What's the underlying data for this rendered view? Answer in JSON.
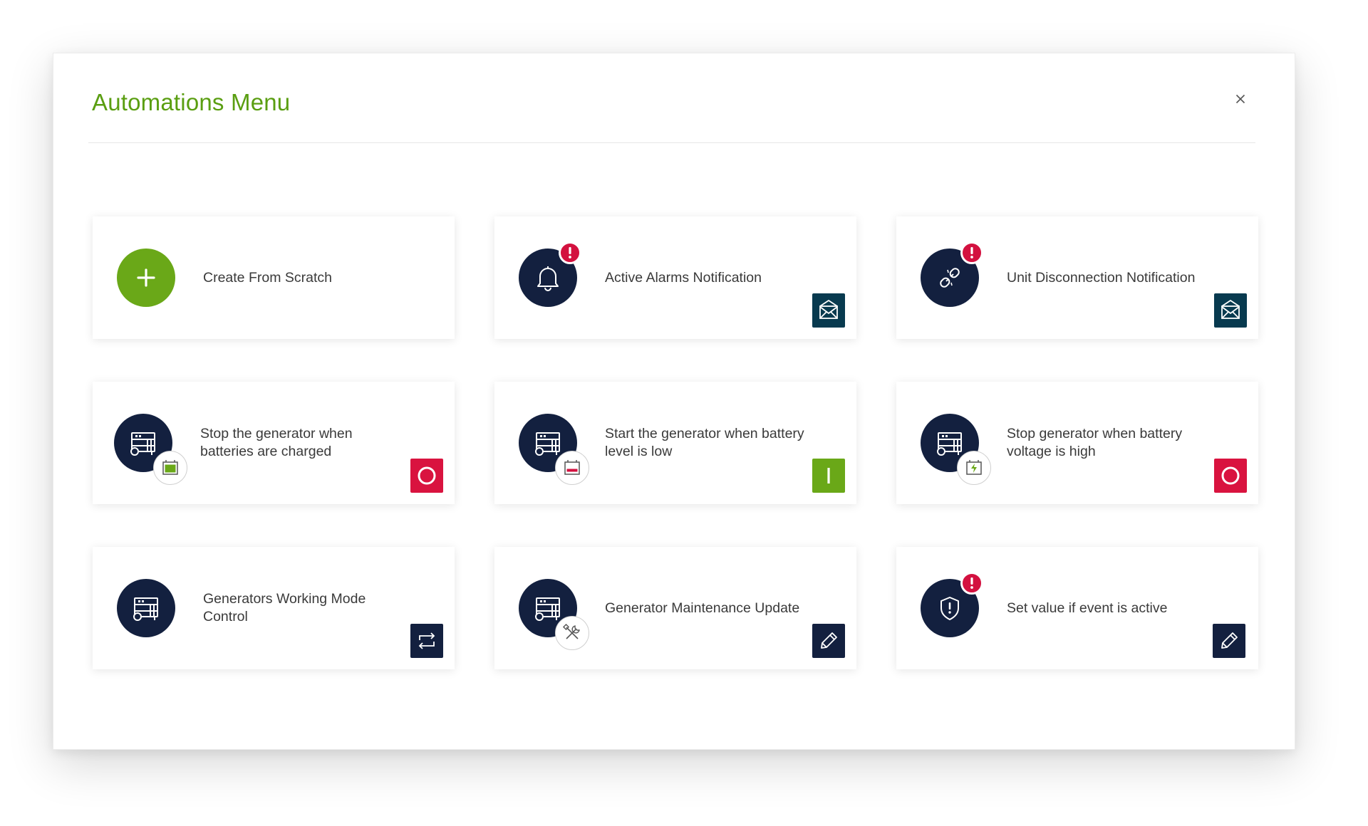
{
  "modal": {
    "title": "Automations Menu",
    "close_label": "×"
  },
  "colors": {
    "title_green": "#5a9e11",
    "navy": "#13203f",
    "teal": "#083a4f",
    "alert_red": "#d3113f",
    "off_red": "#d9133f",
    "on_green": "#6aa818"
  },
  "cards": [
    {
      "label": "Create From Scratch",
      "icon": "plus-icon"
    },
    {
      "label": "Active Alarms Notification",
      "icon": "bell-icon",
      "badge": "alert-icon",
      "action_icon": "envelope-icon"
    },
    {
      "label": "Unit Disconnection Notification",
      "icon": "broken-link-icon",
      "badge": "alert-icon",
      "action_icon": "envelope-icon"
    },
    {
      "label": "Stop the generator when batteries are charged",
      "icon": "generator-icon",
      "sub_icon": "battery-full-icon",
      "action_icon": "power-off-icon"
    },
    {
      "label": "Start the generator when battery level is low",
      "icon": "generator-icon",
      "sub_icon": "battery-low-icon",
      "action_icon": "power-on-icon"
    },
    {
      "label": "Stop generator when battery voltage is high",
      "icon": "generator-icon",
      "sub_icon": "battery-charging-icon",
      "action_icon": "power-off-icon"
    },
    {
      "label": "Generators Working Mode Control",
      "icon": "generator-icon",
      "action_icon": "repeat-icon"
    },
    {
      "label": "Generator Maintenance Update",
      "icon": "generator-icon",
      "sub_icon": "tools-icon",
      "action_icon": "pencil-icon"
    },
    {
      "label": "Set value if event is active",
      "icon": "shield-alert-icon",
      "badge": "alert-icon",
      "action_icon": "pencil-icon"
    }
  ]
}
